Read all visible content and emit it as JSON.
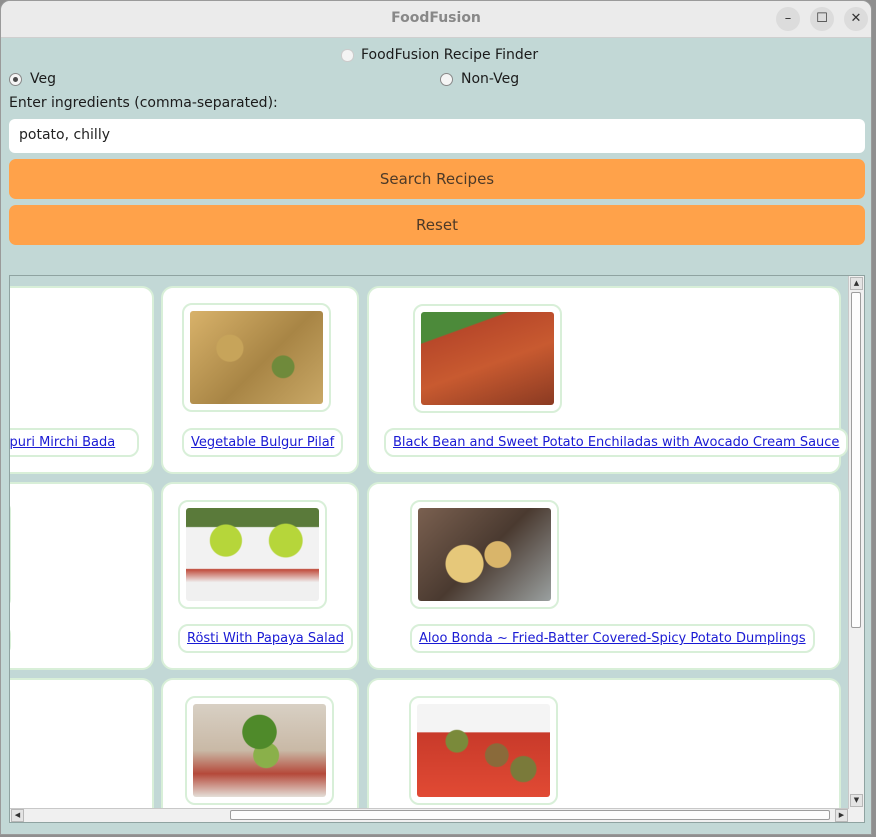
{
  "window": {
    "title": "FoodFusion"
  },
  "app": {
    "heading": "FoodFusion Recipe Finder"
  },
  "filters": {
    "veg_label": "Veg",
    "nonveg_label": "Non-Veg",
    "selected": "Veg"
  },
  "ingredients": {
    "label": "Enter ingredients (comma-separated):",
    "value": "potato, chilly"
  },
  "actions": {
    "search_label": "Search Recipes",
    "reset_label": "Reset"
  },
  "colors": {
    "accent": "#ffa24a",
    "background": "#c2d8d6",
    "link": "#1a1ad4",
    "card_border": "#d8efd8"
  },
  "recipes": {
    "row1": [
      "dhpuri Mirchi Bada",
      "Vegetable Bulgur Pilaf",
      "Black Bean and Sweet Potato Enchiladas with Avocado Cream Sauce"
    ],
    "row2": [
      "Rösti With Papaya Salad",
      "Aloo Bonda ~ Fried-Batter Covered-Spicy Potato Dumplings"
    ]
  }
}
